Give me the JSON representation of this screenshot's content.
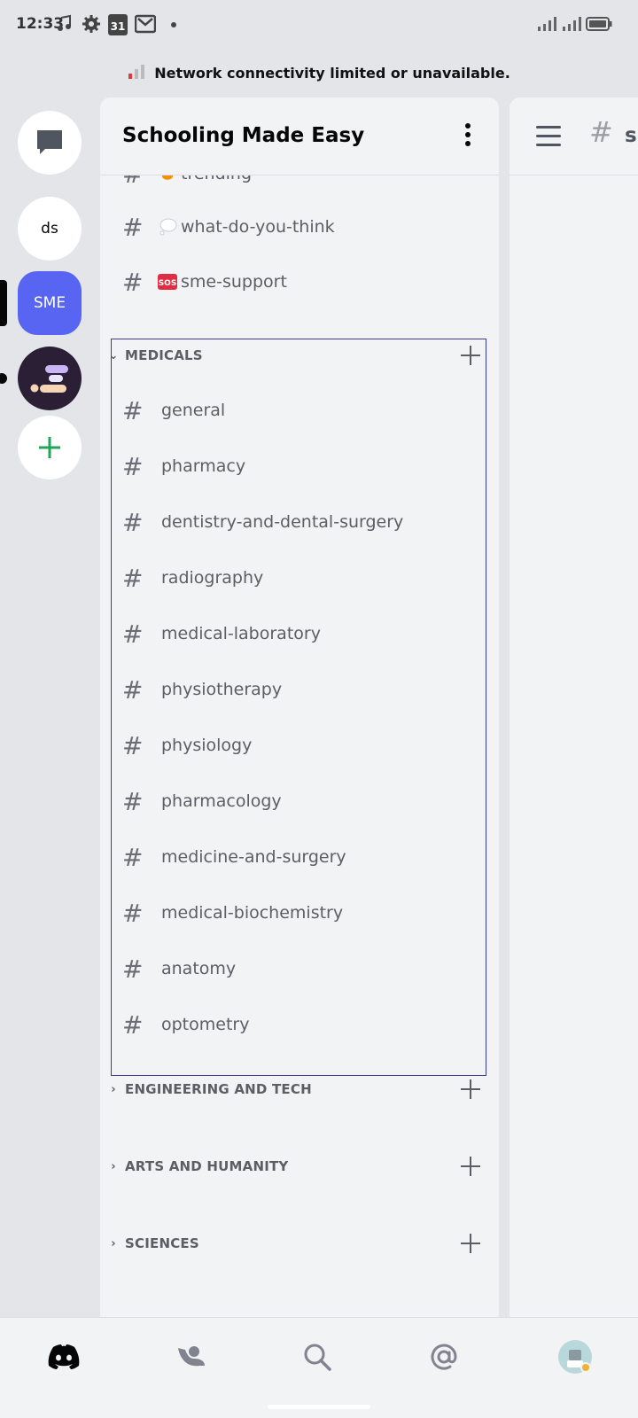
{
  "status_bar": {
    "time": "12:33",
    "calendar_day": "31",
    "icons": [
      "music-note-icon",
      "settings-gear-icon",
      "calendar-icon",
      "gmail-icon",
      "signal-icon",
      "signal-icon",
      "battery-icon"
    ]
  },
  "banner": {
    "text": "Network connectivity limited or unavailable."
  },
  "servers": [
    {
      "name": "direct-messages",
      "icon": "chat-bubble-icon"
    },
    {
      "label": "ds"
    },
    {
      "label": "SME",
      "selected": true,
      "color": "#5865f2"
    },
    {
      "icon": "server-logo-icon",
      "unread": true
    },
    {
      "icon": "add-server-icon",
      "color": "#23a55a"
    }
  ],
  "panel": {
    "title": "Schooling Made Easy",
    "top_channels": [
      {
        "name": "trending",
        "emoji": "fire-icon"
      },
      {
        "name": "what-do-you-think",
        "emoji": "thought-bubble-icon"
      },
      {
        "name": "sme-support",
        "emoji": "sos-icon"
      }
    ],
    "categories": [
      {
        "name": "MEDICALS",
        "expanded": true,
        "channels": [
          "general",
          "pharmacy",
          "dentistry-and-dental-surgery",
          "radiography",
          "medical-laboratory",
          "physiotherapy",
          "physiology",
          "pharmacology",
          "medicine-and-surgery",
          "medical-biochemistry",
          "anatomy",
          "optometry"
        ]
      },
      {
        "name": "ENGINEERING AND TECH",
        "expanded": false
      },
      {
        "name": "ARTS AND HUMANITY",
        "expanded": false
      },
      {
        "name": "SCIENCES",
        "expanded": false
      }
    ]
  },
  "chat": {
    "channel_partial": "s"
  },
  "bottom_nav": {
    "items": [
      "discord-home-icon",
      "friends-icon",
      "search-icon",
      "mentions-icon",
      "profile-avatar-icon"
    ]
  },
  "colors": {
    "accent": "#5865f2",
    "green": "#23a55a",
    "selection_border": "#3b3b8f"
  }
}
